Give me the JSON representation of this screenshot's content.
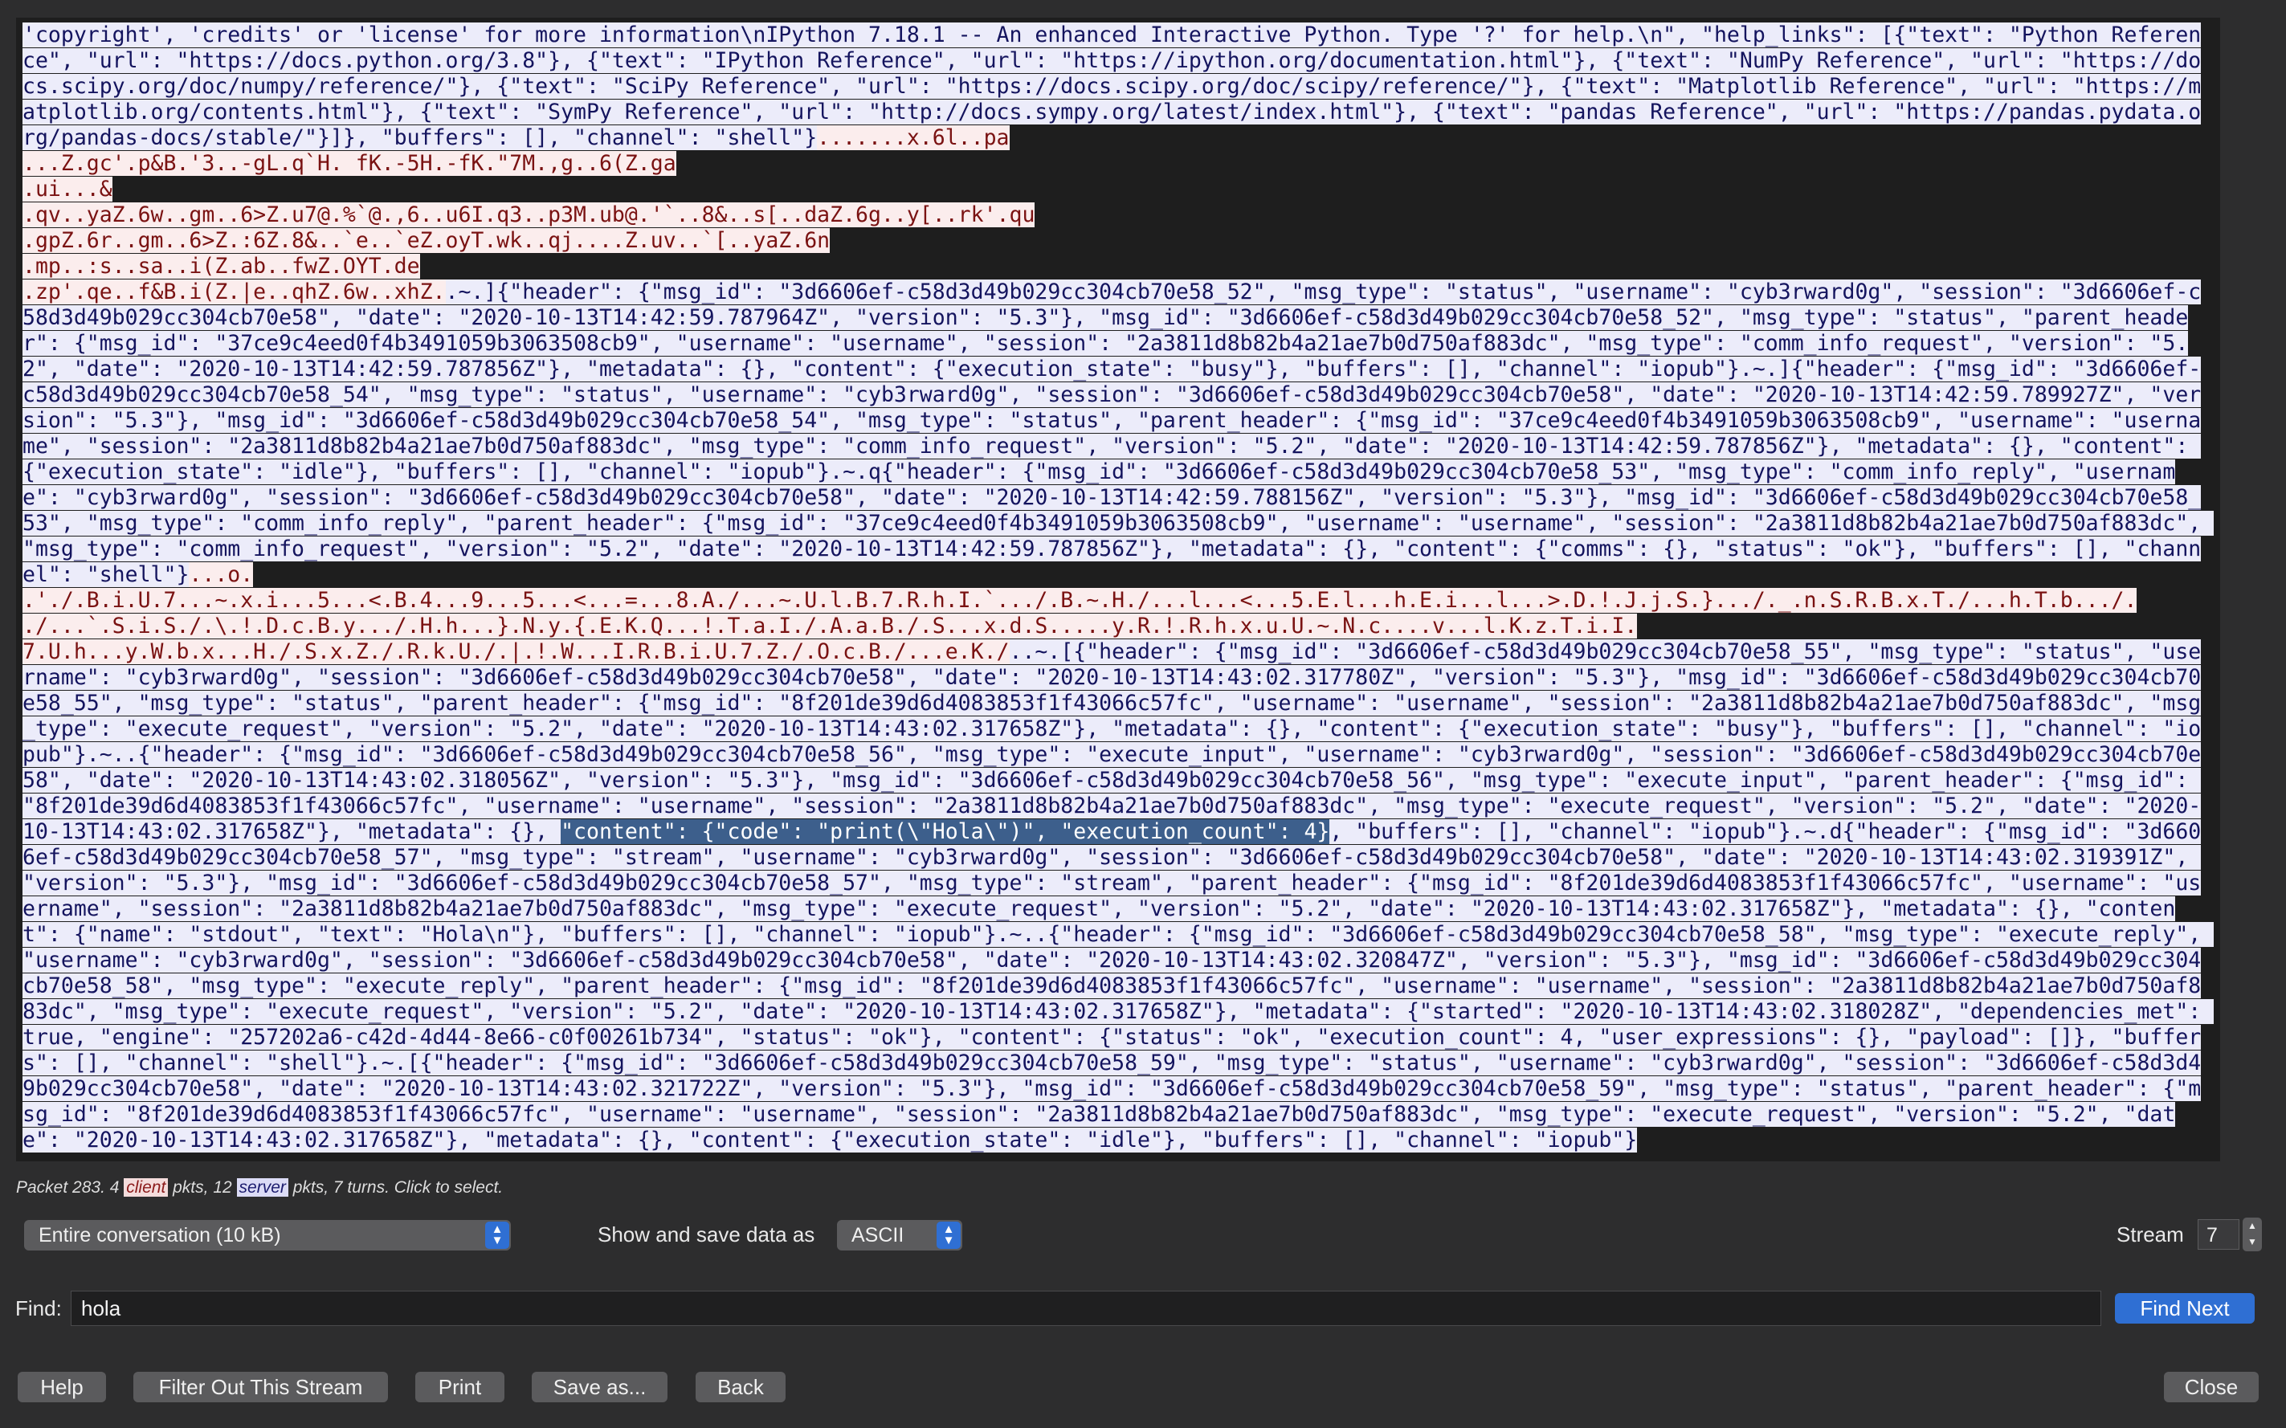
{
  "stream_segments": [
    {
      "dir": "server",
      "text": "'copyright', 'credits' or 'license' for more information\\nIPython 7.18.1 -- An enhanced Interactive Python. Type '?' for help.\\n\", \"help_links\": [{\"text\": \"Python Reference\", \"url\": \"https://docs.python.org/3.8\"}, {\"text\": \"IPython Reference\", \"url\": \"https://ipython.org/documentation.html\"}, {\"text\": \"NumPy Reference\", \"url\": \"https://docs.scipy.org/doc/numpy/reference/\"}, {\"text\": \"SciPy Reference\", \"url\": \"https://docs.scipy.org/doc/scipy/reference/\"}, {\"text\": \"Matplotlib Reference\", \"url\": \"https://matplotlib.org/contents.html\"}, {\"text\": \"SymPy Reference\", \"url\": \"http://docs.sympy.org/latest/index.html\"}, {\"text\": \"pandas Reference\", \"url\": \"https://pandas.pydata.org/pandas-docs/stable/\"}]}, \"buffers\": [], \"channel\": \"shell\"}"
    },
    {
      "dir": "client",
      "text": ".......x.6l..pa\n...Z.gc'.p&B.'3..-gL.q`H. fK.-5H.-fK.\"7M.,g..6(Z.ga\n.ui...&\n.qv..yaZ.6w..gm..6>Z.u7@.%`@.,6..u6I.q3..p3M.ub@.'`..8&..s[..daZ.6g..y[..rk'.qu\n.gpZ.6r..gm..6>Z.:6Z.8&..`e..`eZ.oyT.wk..qj....Z.uv..`[..yaZ.6n\n.mp..:s..sa..i(Z.ab..fwZ.OYT.de\n.zp'.qe..f&B.i(Z.|e..qhZ.6w..xhZ."
    },
    {
      "dir": "server",
      "text": ".~.]{\"header\": {\"msg_id\": \"3d6606ef-c58d3d49b029cc304cb70e58_52\", \"msg_type\": \"status\", \"username\": \"cyb3rward0g\", \"session\": \"3d6606ef-c58d3d49b029cc304cb70e58\", \"date\": \"2020-10-13T14:42:59.787964Z\", \"version\": \"5.3\"}, \"msg_id\": \"3d6606ef-c58d3d49b029cc304cb70e58_52\", \"msg_type\": \"status\", \"parent_header\": {\"msg_id\": \"37ce9c4eed0f4b3491059b3063508cb9\", \"username\": \"username\", \"session\": \"2a3811d8b82b4a21ae7b0d750af883dc\", \"msg_type\": \"comm_info_request\", \"version\": \"5.2\", \"date\": \"2020-10-13T14:42:59.787856Z\"}, \"metadata\": {}, \"content\": {\"execution_state\": \"busy\"}, \"buffers\": [], \"channel\": \"iopub\"}.~.]{\"header\": {\"msg_id\": \"3d6606ef-c58d3d49b029cc304cb70e58_54\", \"msg_type\": \"status\", \"username\": \"cyb3rward0g\", \"session\": \"3d6606ef-c58d3d49b029cc304cb70e58\", \"date\": \"2020-10-13T14:42:59.789927Z\", \"version\": \"5.3\"}, \"msg_id\": \"3d6606ef-c58d3d49b029cc304cb70e58_54\", \"msg_type\": \"status\", \"parent_header\": {\"msg_id\": \"37ce9c4eed0f4b3491059b3063508cb9\", \"username\": \"username\", \"session\": \"2a3811d8b82b4a21ae7b0d750af883dc\", \"msg_type\": \"comm_info_request\", \"version\": \"5.2\", \"date\": \"2020-10-13T14:42:59.787856Z\"}, \"metadata\": {}, \"content\": {\"execution_state\": \"idle\"}, \"buffers\": [], \"channel\": \"iopub\"}.~.q{\"header\": {\"msg_id\": \"3d6606ef-c58d3d49b029cc304cb70e58_53\", \"msg_type\": \"comm_info_reply\", \"username\": \"cyb3rward0g\", \"session\": \"3d6606ef-c58d3d49b029cc304cb70e58\", \"date\": \"2020-10-13T14:42:59.788156Z\", \"version\": \"5.3\"}, \"msg_id\": \"3d6606ef-c58d3d49b029cc304cb70e58_53\", \"msg_type\": \"comm_info_reply\", \"parent_header\": {\"msg_id\": \"37ce9c4eed0f4b3491059b3063508cb9\", \"username\": \"username\", \"session\": \"2a3811d8b82b4a21ae7b0d750af883dc\", \"msg_type\": \"comm_info_request\", \"version\": \"5.2\", \"date\": \"2020-10-13T14:42:59.787856Z\"}, \"metadata\": {}, \"content\": {\"comms\": {}, \"status\": \"ok\"}, \"buffers\": [], \"channel\": \"shell\"}"
    },
    {
      "dir": "client",
      "text": "...o.\n.'./.B.i.U.7...~.x.i...5...<.B.4...9...5...<...=...8.A./...~.U.l.B.7.R.h.I.`.../.B.~.H./...l...<...5.E.l...h.E.i...l...>.D.!.J.j.S.}.../._.n.S.R.B.x.T./...h.T.b.../.\n./...`.S.i.S./.\\.!.D.c.B.y.../.H.h...}.N.y.{.E.K.Q...!.T.a.I./.A.a.B./.S...x.d.S.....y.R.!.R.h.x.u.U.~.N.c....v...l.K.z.T.i.I.\n7.U.h...y.W.b.x...H./.S.x.Z./.R.k.U./.|.!.W...I.R.B.i.U.7.Z./.O.c.B./...e.K./"
    },
    {
      "dir": "server",
      "text": "..~.[{\"header\": {\"msg_id\": \"3d6606ef-c58d3d49b029cc304cb70e58_55\", \"msg_type\": \"status\", \"username\": \"cyb3rward0g\", \"session\": \"3d6606ef-c58d3d49b029cc304cb70e58\", \"date\": \"2020-10-13T14:43:02.317780Z\", \"version\": \"5.3\"}, \"msg_id\": \"3d6606ef-c58d3d49b029cc304cb70e58_55\", \"msg_type\": \"status\", \"parent_header\": {\"msg_id\": \"8f201de39d6d4083853f1f43066c57fc\", \"username\": \"username\", \"session\": \"2a3811d8b82b4a21ae7b0d750af883dc\", \"msg_type\": \"execute_request\", \"version\": \"5.2\", \"date\": \"2020-10-13T14:43:02.317658Z\"}, \"metadata\": {}, \"content\": {\"execution_state\": \"busy\"}, \"buffers\": [], \"channel\": \"iopub\"}.~..{\"header\": {\"msg_id\": \"3d6606ef-c58d3d49b029cc304cb70e58_56\", \"msg_type\": \"execute_input\", \"username\": \"cyb3rward0g\", \"session\": \"3d6606ef-c58d3d49b029cc304cb70e58\", \"date\": \"2020-10-13T14:43:02.318056Z\", \"version\": \"5.3\"}, \"msg_id\": \"3d6606ef-c58d3d49b029cc304cb70e58_56\", \"msg_type\": \"execute_input\", \"parent_header\": {\"msg_id\": \"8f201de39d6d4083853f1f43066c57fc\", \"username\": \"username\", \"session\": \"2a3811d8b82b4a21ae7b0d750af883dc\", \"msg_type\": \"execute_request\", \"version\": \"5.2\", \"date\": \"2020-10-13T14:43:02.317658Z\"}, \"metadata\": {}, "
    },
    {
      "dir": "hl",
      "text": "\"content\": {\"code\": \"print(\\\"Hola\\\")\", \"execution_count\": 4}"
    },
    {
      "dir": "server",
      "text": ", \"buffers\": [], \"channel\": \"iopub\"}.~.d{\"header\": {\"msg_id\": \"3d6606ef-c58d3d49b029cc304cb70e58_57\", \"msg_type\": \"stream\", \"username\": \"cyb3rward0g\", \"session\": \"3d6606ef-c58d3d49b029cc304cb70e58\", \"date\": \"2020-10-13T14:43:02.319391Z\", \"version\": \"5.3\"}, \"msg_id\": \"3d6606ef-c58d3d49b029cc304cb70e58_57\", \"msg_type\": \"stream\", \"parent_header\": {\"msg_id\": \"8f201de39d6d4083853f1f43066c57fc\", \"username\": \"username\", \"session\": \"2a3811d8b82b4a21ae7b0d750af883dc\", \"msg_type\": \"execute_request\", \"version\": \"5.2\", \"date\": \"2020-10-13T14:43:02.317658Z\"}, \"metadata\": {}, \"content\": {\"name\": \"stdout\", \"text\": \"Hola\\n\"}, \"buffers\": [], \"channel\": \"iopub\"}.~..{\"header\": {\"msg_id\": \"3d6606ef-c58d3d49b029cc304cb70e58_58\", \"msg_type\": \"execute_reply\", \"username\": \"cyb3rward0g\", \"session\": \"3d6606ef-c58d3d49b029cc304cb70e58\", \"date\": \"2020-10-13T14:43:02.320847Z\", \"version\": \"5.3\"}, \"msg_id\": \"3d6606ef-c58d3d49b029cc304cb70e58_58\", \"msg_type\": \"execute_reply\", \"parent_header\": {\"msg_id\": \"8f201de39d6d4083853f1f43066c57fc\", \"username\": \"username\", \"session\": \"2a3811d8b82b4a21ae7b0d750af883dc\", \"msg_type\": \"execute_request\", \"version\": \"5.2\", \"date\": \"2020-10-13T14:43:02.317658Z\"}, \"metadata\": {\"started\": \"2020-10-13T14:43:02.318028Z\", \"dependencies_met\": true, \"engine\": \"257202a6-c42d-4d44-8e66-c0f00261b734\", \"status\": \"ok\"}, \"content\": {\"status\": \"ok\", \"execution_count\": 4, \"user_expressions\": {}, \"payload\": []}, \"buffers\": [], \"channel\": \"shell\"}.~.[{\"header\": {\"msg_id\": \"3d6606ef-c58d3d49b029cc304cb70e58_59\", \"msg_type\": \"status\", \"username\": \"cyb3rward0g\", \"session\": \"3d6606ef-c58d3d49b029cc304cb70e58\", \"date\": \"2020-10-13T14:43:02.321722Z\", \"version\": \"5.3\"}, \"msg_id\": \"3d6606ef-c58d3d49b029cc304cb70e58_59\", \"msg_type\": \"status\", \"parent_header\": {\"msg_id\": \"8f201de39d6d4083853f1f43066c57fc\", \"username\": \"username\", \"session\": \"2a3811d8b82b4a21ae7b0d750af883dc\", \"msg_type\": \"execute_request\", \"version\": \"5.2\", \"date\": \"2020-10-13T14:43:02.317658Z\"}, \"metadata\": {}, \"content\": {\"execution_state\": \"idle\"}, \"buffers\": [], \"channel\": \"iopub\"}"
    }
  ],
  "status": {
    "prefix": "Packet 283. 4 ",
    "client_word": "client",
    "middle": " pkts, 12 ",
    "server_word": "server",
    "suffix": " pkts, 7 turns. Click to select."
  },
  "conversation_select": {
    "value": "Entire conversation (10 kB)"
  },
  "show_save_label": "Show and save data as",
  "encoding_select": {
    "value": "ASCII"
  },
  "stream": {
    "label": "Stream",
    "value": "7"
  },
  "find": {
    "label": "Find:",
    "value": "hola",
    "button": "Find Next"
  },
  "buttons": {
    "help": "Help",
    "filter_out": "Filter Out This Stream",
    "print": "Print",
    "save_as": "Save as...",
    "back": "Back",
    "close": "Close"
  },
  "colors": {
    "client_bg": "#fbeded",
    "client_fg": "#7a1212",
    "server_bg": "#ececfa",
    "server_fg": "#14145e",
    "highlight_bg": "#3d5f8c",
    "accent": "#2f6fd3"
  }
}
